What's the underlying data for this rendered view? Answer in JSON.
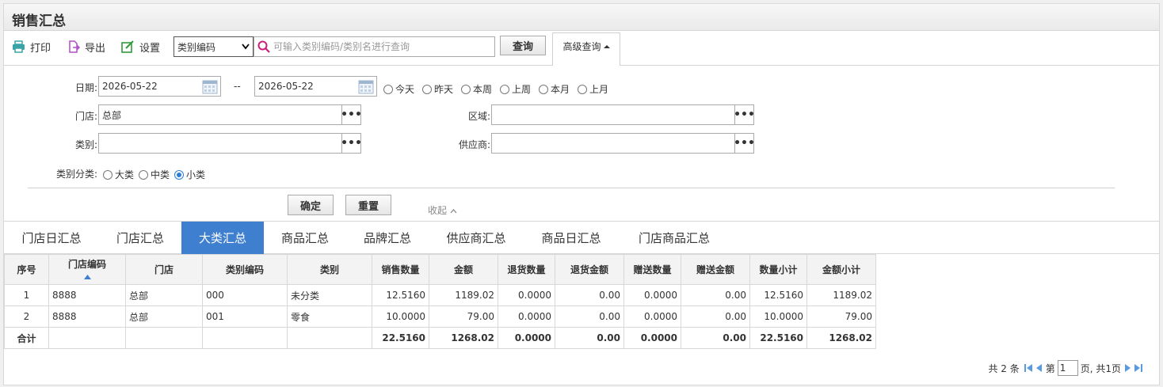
{
  "title": "销售汇总",
  "toolbar": {
    "print": "打印",
    "export": "导出",
    "settings": "设置",
    "select_value": "类别编码",
    "search_placeholder": "可输入类别编码/类别名进行查询",
    "query": "查询",
    "advanced": "高级查询"
  },
  "form": {
    "date_label": "日期:",
    "date_from": "2026-05-22",
    "date_sep": "--",
    "date_to": "2026-05-22",
    "quick_dates": [
      "今天",
      "昨天",
      "本周",
      "上周",
      "本月",
      "上月"
    ],
    "store_label": "门店:",
    "store_value": "总部",
    "area_label": "区域:",
    "area_value": "",
    "category_label": "类别:",
    "category_value": "",
    "supplier_label": "供应商:",
    "supplier_value": "",
    "class_label": "类别分类:",
    "class_options": [
      "大类",
      "中类",
      "小类"
    ],
    "class_selected": "小类",
    "confirm": "确定",
    "reset": "重置",
    "collapse": "收起"
  },
  "tabs": [
    "门店日汇总",
    "门店汇总",
    "大类汇总",
    "商品汇总",
    "品牌汇总",
    "供应商汇总",
    "商品日汇总",
    "门店商品汇总"
  ],
  "active_tab": "大类汇总",
  "table": {
    "headers": [
      "序号",
      "门店编码",
      "门店",
      "类别编码",
      "类别",
      "销售数量",
      "金额",
      "退货数量",
      "退货金额",
      "赠送数量",
      "赠送金额",
      "数量小计",
      "金额小计"
    ],
    "rows": [
      [
        "1",
        "8888",
        "总部",
        "000",
        "未分类",
        "12.5160",
        "1189.02",
        "0.0000",
        "0.00",
        "0.0000",
        "0.00",
        "12.5160",
        "1189.02"
      ],
      [
        "2",
        "8888",
        "总部",
        "001",
        "零食",
        "10.0000",
        "79.00",
        "0.0000",
        "0.00",
        "0.0000",
        "0.00",
        "10.0000",
        "79.00"
      ]
    ],
    "total": [
      "合计",
      "",
      "",
      "",
      "",
      "22.5160",
      "1268.02",
      "0.0000",
      "0.00",
      "0.0000",
      "0.00",
      "22.5160",
      "1268.02"
    ]
  },
  "pager": {
    "total_text": "共 2 条",
    "page_prefix": "第",
    "page_value": "1",
    "page_suffix": "页, 共1页"
  },
  "colors": {
    "accent": "#3f7fd0",
    "print_icon": "#3aa3a8",
    "export_icon": "#b04fc4",
    "settings_icon": "#2f9a3a",
    "search_icon": "#c8207a"
  }
}
